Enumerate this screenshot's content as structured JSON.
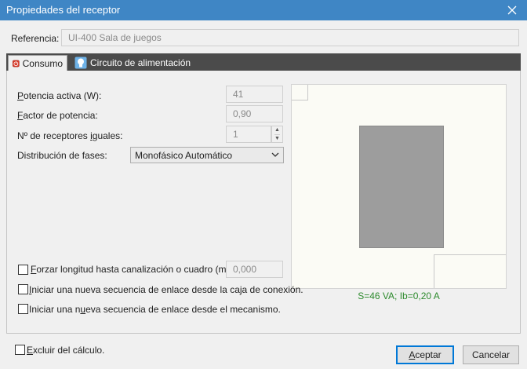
{
  "window": {
    "title": "Propiedades del receptor"
  },
  "referencia": {
    "label": "Referencia:",
    "value": "UI-400 Sala de juegos"
  },
  "tabs": [
    {
      "label": "Consumo",
      "active": true,
      "icon": "power-icon"
    },
    {
      "label": "Circuito de alimentación",
      "active": false,
      "icon": "lightbulb-icon"
    }
  ],
  "consumo": {
    "potencia": {
      "label_pre": "",
      "label_key": "P",
      "label_post": "otencia activa (W):",
      "value": "41"
    },
    "factor": {
      "label_pre": "",
      "label_key": "F",
      "label_post": "actor de potencia:",
      "value": "0,90"
    },
    "receptores": {
      "label_pre": "Nº de receptores ",
      "label_key": "i",
      "label_post": "guales:",
      "value": "1"
    },
    "distribucion": {
      "label": "Distribución de fases:",
      "value": "Monofásico Automático"
    }
  },
  "options": {
    "forzar": {
      "label_pre": "",
      "label_key": "F",
      "label_post": "orzar longitud hasta canalización o cuadro (m):",
      "value": "0,000",
      "checked": false
    },
    "iniciar_caja": {
      "label_pre": "",
      "label_key": "I",
      "label_post": "niciar una nueva secuencia de enlace desde la caja de conexión.",
      "checked": false
    },
    "iniciar_mecanismo": {
      "label_pre": "Iniciar una n",
      "label_key": "u",
      "label_post": "eva secuencia de enlace desde el mecanismo.",
      "checked": false
    }
  },
  "preview": {
    "summary": "S=46 VA; Ib=0,20 A"
  },
  "footer": {
    "excluir": {
      "label_pre": "",
      "label_key": "E",
      "label_post": "xcluir del cálculo.",
      "checked": false
    },
    "accept": {
      "label_pre": "",
      "label_key": "A",
      "label_post": "ceptar"
    },
    "cancel": {
      "label": "Cancelar"
    }
  },
  "colors": {
    "titlebar": "#3f86c5",
    "tab_strip": "#4b4b4b",
    "summary_text": "#2d8a2d",
    "accept_border": "#0078d7"
  }
}
